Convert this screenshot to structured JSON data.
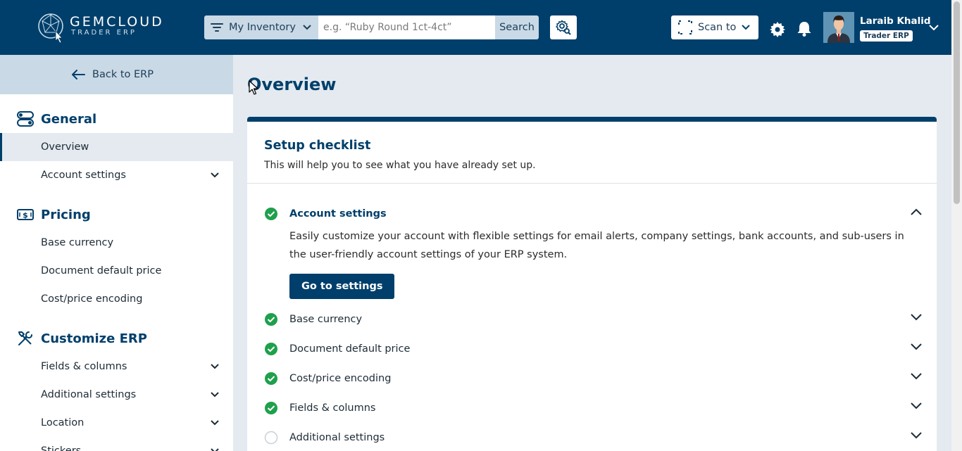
{
  "header": {
    "logo_name": "GEMCLOUD",
    "logo_sub": "TRADER ERP",
    "inventory_select": "My Inventory",
    "search_placeholder": "e.g. “Ruby Round 1ct-4ct”",
    "search_button": "Search",
    "scan_label": "Scan to",
    "user_name": "Laraib Khalid",
    "user_role": "Trader ERP"
  },
  "sidebar": {
    "back_label": "Back to ERP",
    "groups": [
      {
        "title": "General",
        "icon": "toggle-icon",
        "items": [
          {
            "label": "Overview",
            "active": true,
            "expandable": false
          },
          {
            "label": "Account settings",
            "expandable": true
          }
        ]
      },
      {
        "title": "Pricing",
        "icon": "money-icon",
        "items": [
          {
            "label": "Base currency",
            "expandable": false
          },
          {
            "label": "Document default price",
            "expandable": false
          },
          {
            "label": "Cost/price encoding",
            "expandable": false
          }
        ]
      },
      {
        "title": "Customize ERP",
        "icon": "tools-icon",
        "items": [
          {
            "label": "Fields & columns",
            "expandable": true
          },
          {
            "label": "Additional settings",
            "expandable": true
          },
          {
            "label": "Location",
            "expandable": true
          },
          {
            "label": "Stickers",
            "expandable": true
          }
        ]
      }
    ]
  },
  "main": {
    "page_title": "Overview",
    "checklist": {
      "title": "Setup checklist",
      "subtitle": "This will help you to see what you have already set up.",
      "items": [
        {
          "label": "Account settings",
          "done": true,
          "expanded": true,
          "description": "Easily customize your account with flexible settings for email alerts, company settings, bank accounts, and sub-users in the user-friendly account settings of your ERP system.",
          "button": "Go to settings"
        },
        {
          "label": "Base currency",
          "done": true
        },
        {
          "label": "Document default price",
          "done": true
        },
        {
          "label": "Cost/price encoding",
          "done": true
        },
        {
          "label": "Fields & columns",
          "done": true
        },
        {
          "label": "Additional settings",
          "done": false
        }
      ]
    }
  },
  "colors": {
    "brand": "#003f6b",
    "accent_light": "#c9d9e6",
    "success": "#1ea04c"
  }
}
